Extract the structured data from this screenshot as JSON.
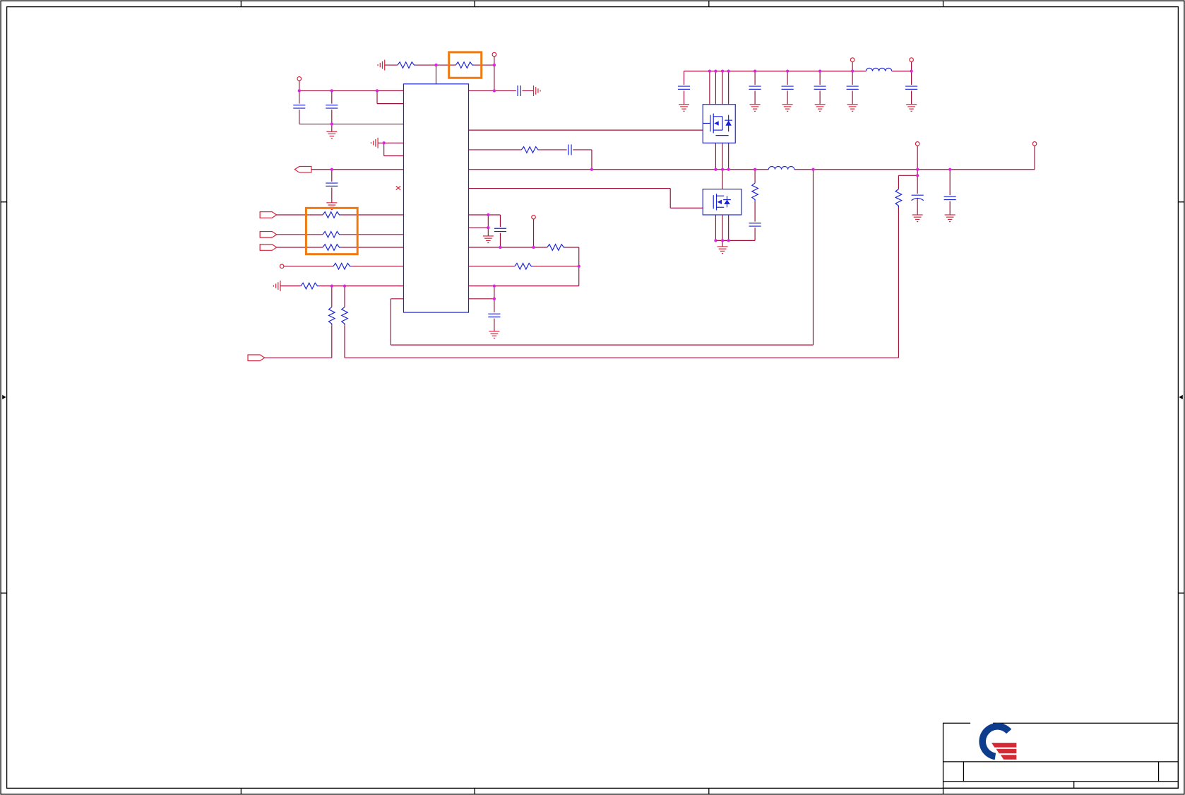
{
  "colors": {
    "wire": "#a0103a",
    "power_symbol": "#d9213a",
    "component": "#1a22d8",
    "junction": "#e020e0",
    "highlight": "#f07a12",
    "logo_blue": "#0d3d8c",
    "logo_red": "#d42a36"
  },
  "title_block": {
    "logo": "quanta-logo"
  }
}
